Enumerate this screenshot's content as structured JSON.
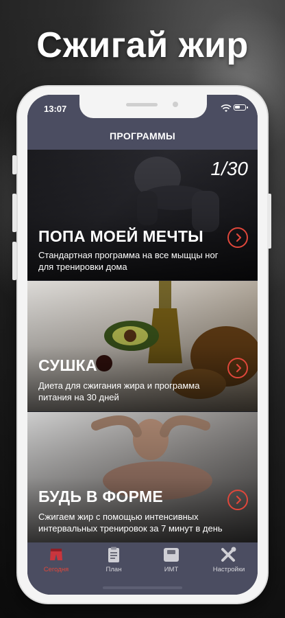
{
  "headline": "Сжигай жир",
  "status_bar": {
    "time": "13:07"
  },
  "nav": {
    "title": "ПРОГРАММЫ"
  },
  "programs": [
    {
      "counter": "1/30",
      "title": "ПОПА МОЕЙ МЕЧТЫ",
      "description": "Стандартная программа на все мыщцы ног для тренировки дома"
    },
    {
      "title": "СУШКА",
      "description": "Диета для сжигания жира и программа питания на 30 дней"
    },
    {
      "title": "БУДЬ В ФОРМЕ",
      "description": "Сжигаем жир с помощью интенсивных интервальных тренировок за 7 минут в день"
    }
  ],
  "tabs": [
    {
      "label": "Сегодня",
      "icon": "shorts-icon",
      "active": true
    },
    {
      "label": "План",
      "icon": "clipboard-icon",
      "active": false
    },
    {
      "label": "ИМТ",
      "icon": "scale-icon",
      "active": false
    },
    {
      "label": "Настройки",
      "icon": "tools-icon",
      "active": false
    }
  ],
  "colors": {
    "accent": "#e0473b",
    "bar": "#4b4d61"
  }
}
